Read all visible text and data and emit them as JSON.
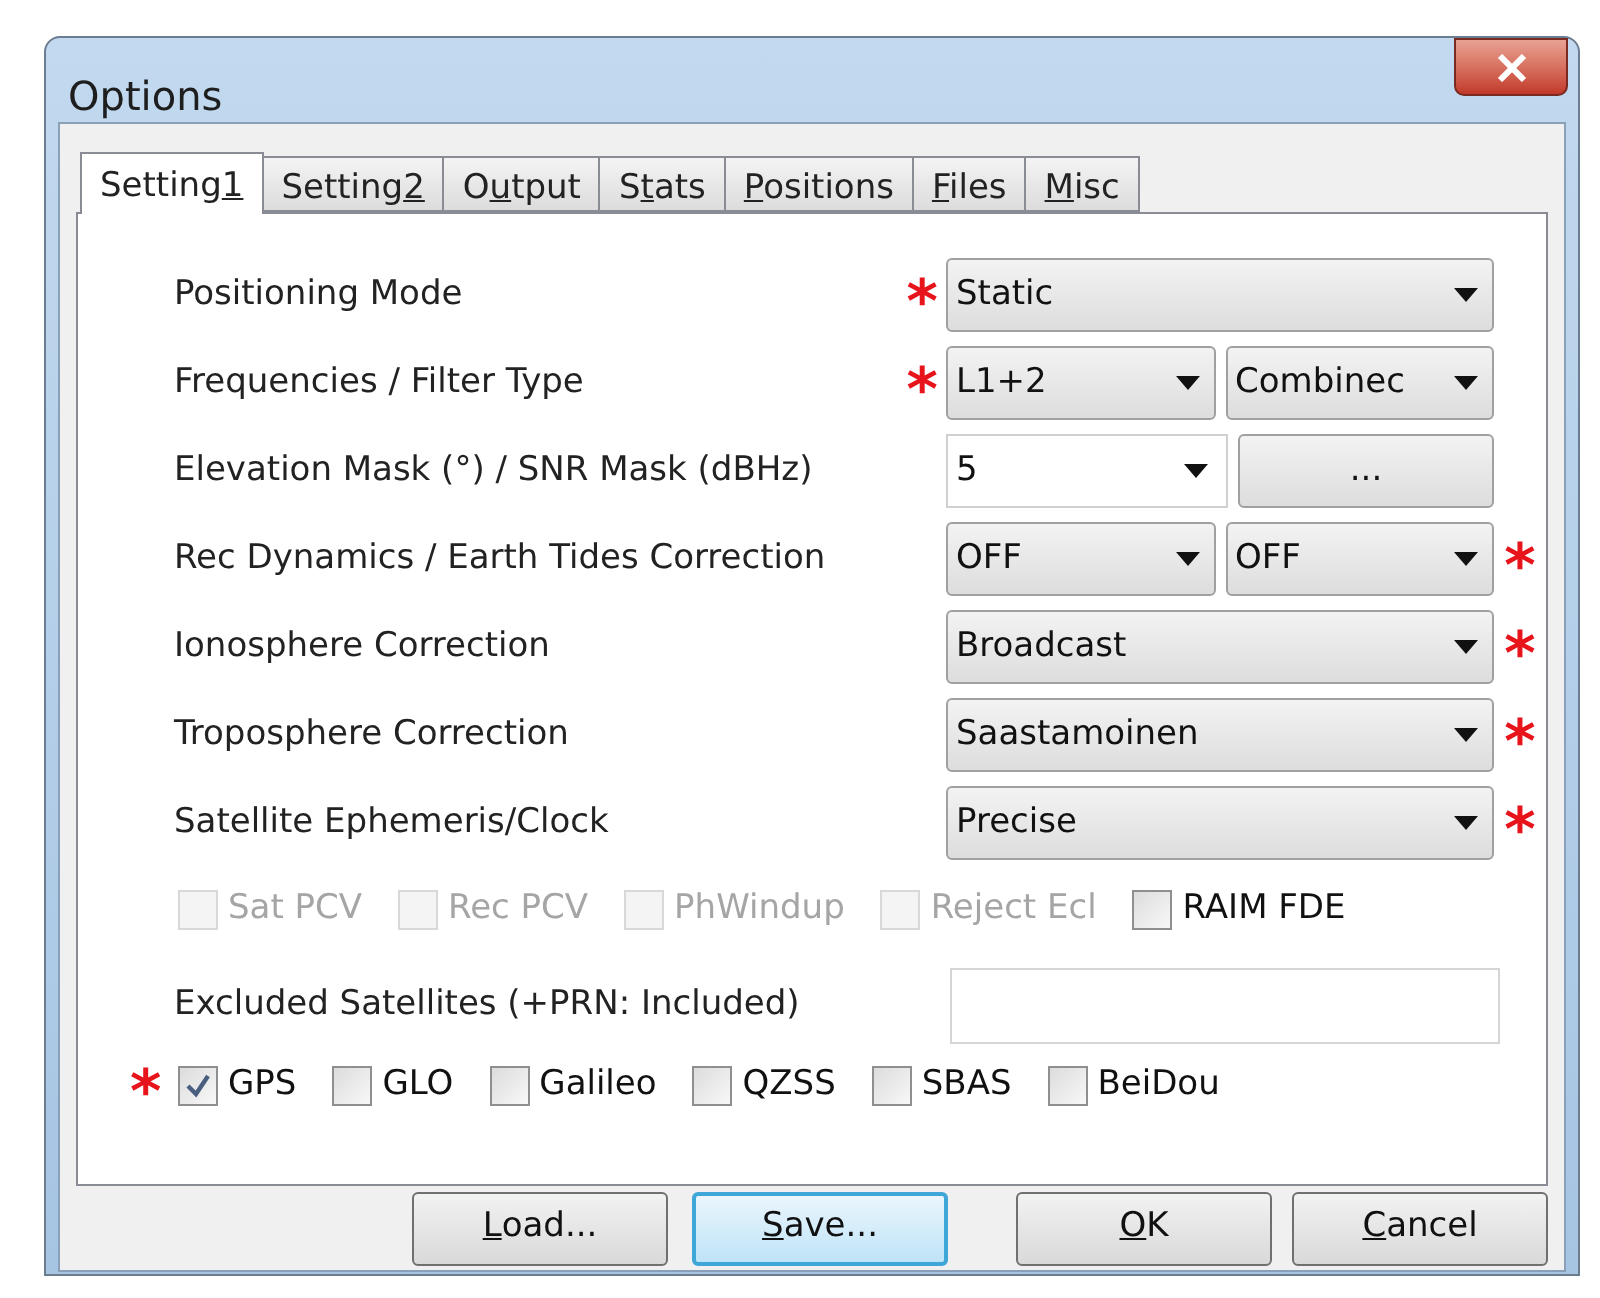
{
  "window": {
    "title": "Options"
  },
  "tabs": [
    {
      "label": [
        {
          "t": "Setting"
        },
        {
          "t": "1",
          "u": true
        }
      ],
      "selected": true
    },
    {
      "label": [
        {
          "t": "Setting"
        },
        {
          "t": "2",
          "u": true
        }
      ],
      "selected": false
    },
    {
      "label": [
        {
          "t": "O"
        },
        {
          "t": "u",
          "u": true
        },
        {
          "t": "tput"
        }
      ],
      "selected": false
    },
    {
      "label": [
        {
          "t": "S"
        },
        {
          "t": "t",
          "u": true
        },
        {
          "t": "ats"
        }
      ],
      "selected": false
    },
    {
      "label": [
        {
          "t": "P",
          "u": true
        },
        {
          "t": "ositions"
        }
      ],
      "selected": false
    },
    {
      "label": [
        {
          "t": "F",
          "u": true
        },
        {
          "t": "iles"
        }
      ],
      "selected": false
    },
    {
      "label": [
        {
          "t": "M",
          "u": true
        },
        {
          "t": "isc"
        }
      ],
      "selected": false
    }
  ],
  "settings": [
    {
      "label": "Positioning Mode",
      "asterisk_left": "*",
      "controls": [
        {
          "kind": "combo",
          "value": "Static"
        }
      ]
    },
    {
      "label": "Frequencies / Filter Type",
      "asterisk_left": "*",
      "controls": [
        {
          "kind": "combo",
          "value": "L1+2"
        },
        {
          "kind": "combo",
          "value": "Combinec"
        }
      ]
    },
    {
      "label": "Elevation Mask (°) / SNR Mask (dBHz)",
      "controls": [
        {
          "kind": "edit-combo",
          "value": "5"
        },
        {
          "kind": "button",
          "value": "..."
        }
      ]
    },
    {
      "label": "Rec Dynamics / Earth Tides Correction",
      "asterisk_right": "*",
      "controls": [
        {
          "kind": "combo",
          "value": "OFF"
        },
        {
          "kind": "combo",
          "value": "OFF"
        }
      ]
    },
    {
      "label": "Ionosphere Correction",
      "asterisk_right": "*",
      "controls": [
        {
          "kind": "combo",
          "value": "Broadcast"
        }
      ]
    },
    {
      "label": "Troposphere Correction",
      "asterisk_right": "*",
      "controls": [
        {
          "kind": "combo",
          "value": "Saastamoinen"
        }
      ]
    },
    {
      "label": "Satellite Ephemeris/Clock",
      "asterisk_right": "*",
      "controls": [
        {
          "kind": "combo",
          "value": "Precise"
        }
      ]
    }
  ],
  "options": [
    {
      "label": "Sat PCV",
      "checked": false,
      "disabled": true
    },
    {
      "label": "Rec PCV",
      "checked": false,
      "disabled": true
    },
    {
      "label": "PhWindup",
      "checked": false,
      "disabled": true
    },
    {
      "label": "Reject Ecl",
      "checked": false,
      "disabled": true
    },
    {
      "label": "RAIM FDE",
      "checked": false,
      "disabled": false
    }
  ],
  "excluded_satellites": {
    "label": "Excluded Satellites (+PRN: Included)"
  },
  "systems": [
    {
      "label": "GPS",
      "checked": true,
      "asterisk": "*"
    },
    {
      "label": "GLO",
      "checked": false
    },
    {
      "label": "Galileo",
      "checked": false
    },
    {
      "label": "QZSS",
      "checked": false
    },
    {
      "label": "SBAS",
      "checked": false
    },
    {
      "label": "BeiDou",
      "checked": false
    }
  ],
  "buttons": [
    {
      "label": [
        {
          "t": "L",
          "u": true
        },
        {
          "t": "oad..."
        }
      ],
      "focused": false
    },
    {
      "label": [
        {
          "t": "S",
          "u": true
        },
        {
          "t": "ave..."
        }
      ],
      "focused": true
    },
    {
      "label": [
        {
          "t": "O",
          "u": true
        },
        {
          "t": "K"
        }
      ],
      "focused": false
    },
    {
      "label": [
        {
          "t": "C",
          "u": true
        },
        {
          "t": "ancel"
        }
      ],
      "focused": false
    }
  ]
}
